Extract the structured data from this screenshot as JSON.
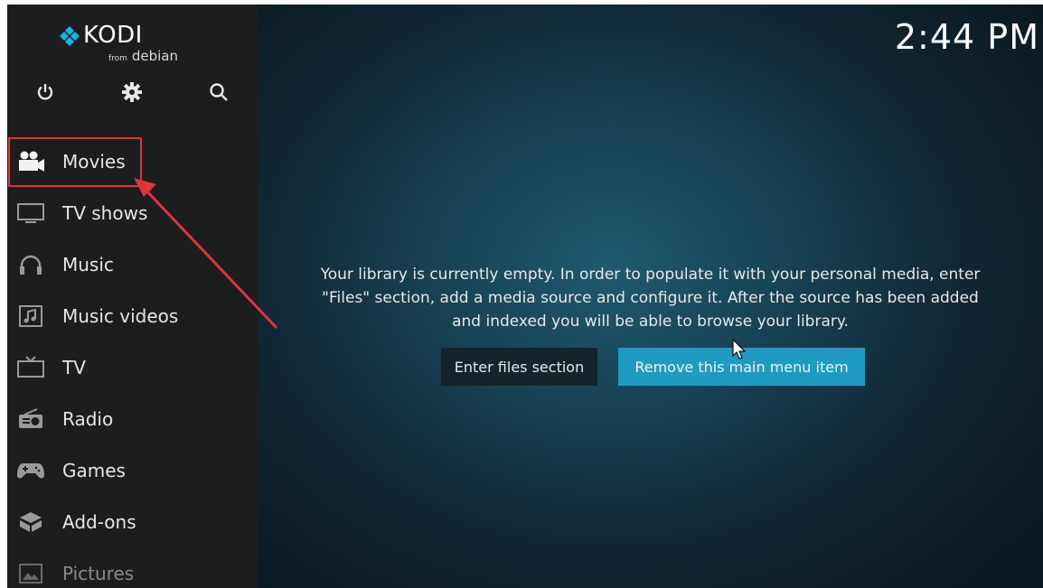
{
  "app": {
    "logo_text": "KODI",
    "logo_from": "from",
    "logo_distro": "debian"
  },
  "top_icons": [
    "power-icon",
    "gear-icon",
    "search-icon"
  ],
  "clock": "2:44 PM",
  "menu": [
    {
      "label": "Movies",
      "icon": "movie-camera-icon"
    },
    {
      "label": "TV shows",
      "icon": "monitor-icon"
    },
    {
      "label": "Music",
      "icon": "headphones-icon"
    },
    {
      "label": "Music videos",
      "icon": "music-video-icon"
    },
    {
      "label": "TV",
      "icon": "tv-icon"
    },
    {
      "label": "Radio",
      "icon": "radio-icon"
    },
    {
      "label": "Games",
      "icon": "gamepad-icon"
    },
    {
      "label": "Add-ons",
      "icon": "addon-box-icon"
    },
    {
      "label": "Pictures",
      "icon": "picture-icon"
    }
  ],
  "main": {
    "message_lines": [
      "Your library is currently empty. In order to populate it with your personal media, enter",
      "\"Files\" section, add a media source and configure it. After the source has been added",
      "and indexed you will be able to browse your library."
    ],
    "enter_button": "Enter files section",
    "remove_button": "Remove this main menu item"
  },
  "colors": {
    "highlight_box": "#e0343a",
    "accent_button": "#1f9bc1",
    "sidebar_bg": "#1c1d1f"
  }
}
